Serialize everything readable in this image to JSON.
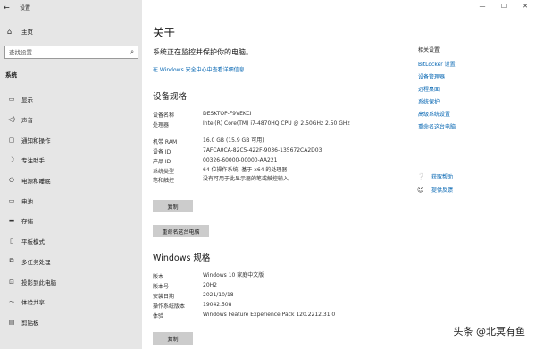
{
  "app": {
    "title": "设置",
    "back_icon": "back-arrow-icon"
  },
  "window_controls": [
    "—",
    "☐",
    "✕"
  ],
  "sidebar": {
    "home_label": "主页",
    "search_placeholder": "查找设置",
    "section_label": "系统",
    "items": [
      {
        "label": "显示",
        "icon": "monitor-icon"
      },
      {
        "label": "声音",
        "icon": "speaker-icon"
      },
      {
        "label": "通知和操作",
        "icon": "notification-icon"
      },
      {
        "label": "专注助手",
        "icon": "moon-icon"
      },
      {
        "label": "电源和睡眠",
        "icon": "power-icon"
      },
      {
        "label": "电池",
        "icon": "battery-icon"
      },
      {
        "label": "存储",
        "icon": "storage-icon"
      },
      {
        "label": "平板模式",
        "icon": "tablet-icon"
      },
      {
        "label": "多任务处理",
        "icon": "multitask-icon"
      },
      {
        "label": "投影到此电脑",
        "icon": "projector-icon"
      },
      {
        "label": "体验共享",
        "icon": "share-icon"
      },
      {
        "label": "剪贴板",
        "icon": "clipboard-icon"
      }
    ]
  },
  "main": {
    "title": "关于",
    "protect_text": "系统正在监控并保护你的电脑。",
    "wsc_link": "在 Windows 安全中心中查看详细信息",
    "device_specs": {
      "heading": "设备规格",
      "rows": [
        {
          "k": "设备名称",
          "v": "DESKTOP-F9VEKCI"
        },
        {
          "k": "处理器",
          "v": "Intel(R) Core(TM) i7-4870HQ CPU @ 2.50GHz   2.50 GHz"
        },
        {
          "k": "机带 RAM",
          "v": "16.0 GB (15.9 GB 可用)"
        },
        {
          "k": "设备 ID",
          "v": "7AFCA0CA-82C5-422F-9036-135672CA2D03"
        },
        {
          "k": "产品 ID",
          "v": "00326-60000-00000-AA221"
        },
        {
          "k": "系统类型",
          "v": "64 位操作系统, 基于 x64 的处理器"
        },
        {
          "k": "笔和触控",
          "v": "没有可用于此显示器的笔或触控输入"
        }
      ],
      "copy_button": "复制",
      "rename_button": "重命名这台电脑"
    },
    "windows_specs": {
      "heading": "Windows 规格",
      "rows": [
        {
          "k": "版本",
          "v": "Windows 10 家庭中文版"
        },
        {
          "k": "版本号",
          "v": "20H2"
        },
        {
          "k": "安装日期",
          "v": "2021/10/18"
        },
        {
          "k": "操作系统版本",
          "v": "19042.508"
        },
        {
          "k": "体验",
          "v": "Windows Feature Experience Pack 120.2212.31.0"
        }
      ],
      "copy_button": "复制"
    }
  },
  "related": {
    "title": "相关设置",
    "links": [
      "BitLocker 设置",
      "设备管理器",
      "远程桌面",
      "系统保护",
      "高级系统设置",
      "重命名这台电脑"
    ],
    "help_label": "获取帮助",
    "feedback_label": "提供反馈"
  },
  "watermark": "头条 @北冥有鱼"
}
